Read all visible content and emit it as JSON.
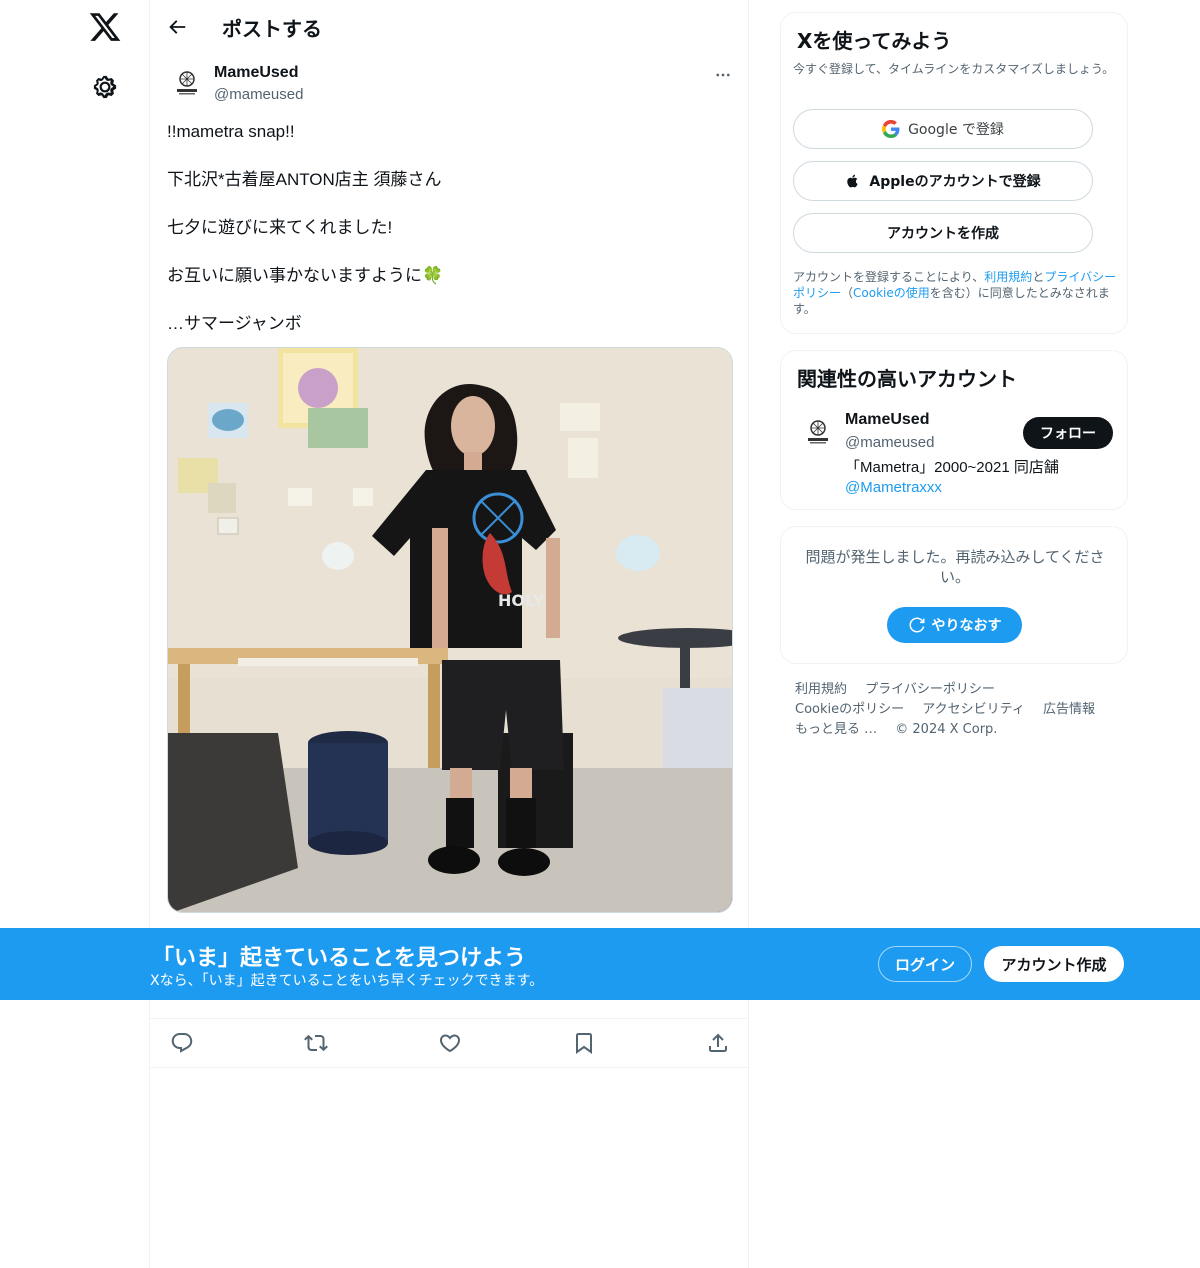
{
  "header": {
    "title": "ポストする"
  },
  "post": {
    "author_name": "MameUsed",
    "author_handle": "@mameused",
    "text_lines": [
      "!!mametra snap!!",
      "下北沢*古着屋ANTON店主 須藤さん",
      "七夕に遊びに来てくれました!",
      "お互いに願い事かないますように🍀",
      "…サマージャンボ"
    ],
    "photo_alt": "画像",
    "shirt_text": "HOLY"
  },
  "signup": {
    "title": "Xを使ってみよう",
    "subtitle": "今すぐ登録して、タイムラインをカスタマイズしましょう。",
    "google_label": "Google で登録",
    "apple_label": "Appleのアカウントで登録",
    "create_label": "アカウントを作成",
    "terms_pre": "アカウントを登録することにより、",
    "terms_link1": "利用規約",
    "terms_mid1": "と",
    "terms_link2": "プライバシーポリシー",
    "terms_mid2": "（",
    "terms_link3": "Cookieの使用",
    "terms_post": "を含む）に同意したとみなされます。"
  },
  "related": {
    "title": "関連性の高いアカウント",
    "name": "MameUsed",
    "handle": "@mameused",
    "follow_label": "フォロー",
    "bio": "「Mametra」2000~2021 同店舗",
    "bio_link": "@Mametraxxx"
  },
  "error": {
    "message": "問題が発生しました。再読み込みしてください。",
    "retry_label": "やりなおす"
  },
  "footer": {
    "links": [
      "利用規約",
      "プライバシーポリシー",
      "Cookieのポリシー",
      "アクセシビリティ",
      "広告情報",
      "もっと見る …",
      "© 2024 X Corp."
    ]
  },
  "banner": {
    "title": "「いま」起きていることを見つけよう",
    "subtitle": "Xなら、「いま」起きていることをいち早くチェックできます。",
    "login_label": "ログイン",
    "signup_label": "アカウント作成"
  },
  "icons": {
    "logo": "x-logo-icon",
    "settings": "gear-icon",
    "back": "back-arrow-icon",
    "more": "more-dots-icon",
    "reply": "reply-icon",
    "repost": "repost-icon",
    "like": "heart-icon",
    "bookmark": "bookmark-icon",
    "share": "share-icon"
  },
  "colors": {
    "accent": "#1d9bf0",
    "text": "#0f1419",
    "muted": "#536471"
  }
}
